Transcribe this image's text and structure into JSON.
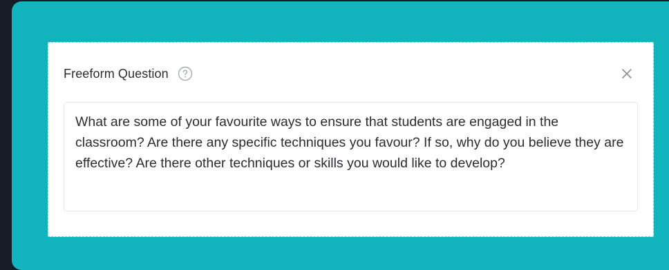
{
  "card": {
    "title": "Freeform Question",
    "help_icon": "question-circle-icon",
    "close_icon": "close-icon",
    "question_text": "What are some of your favourite ways to ensure that students are engaged in the classroom? Are there any specific techniques you favour? If so, why do you believe they are effective? Are there other techniques or skills you would like to develop?"
  },
  "colors": {
    "background": "#171b26",
    "panel": "#11b3bc",
    "card": "#ffffff",
    "text": "#2b2b33",
    "icon": "#9aa0a6"
  }
}
